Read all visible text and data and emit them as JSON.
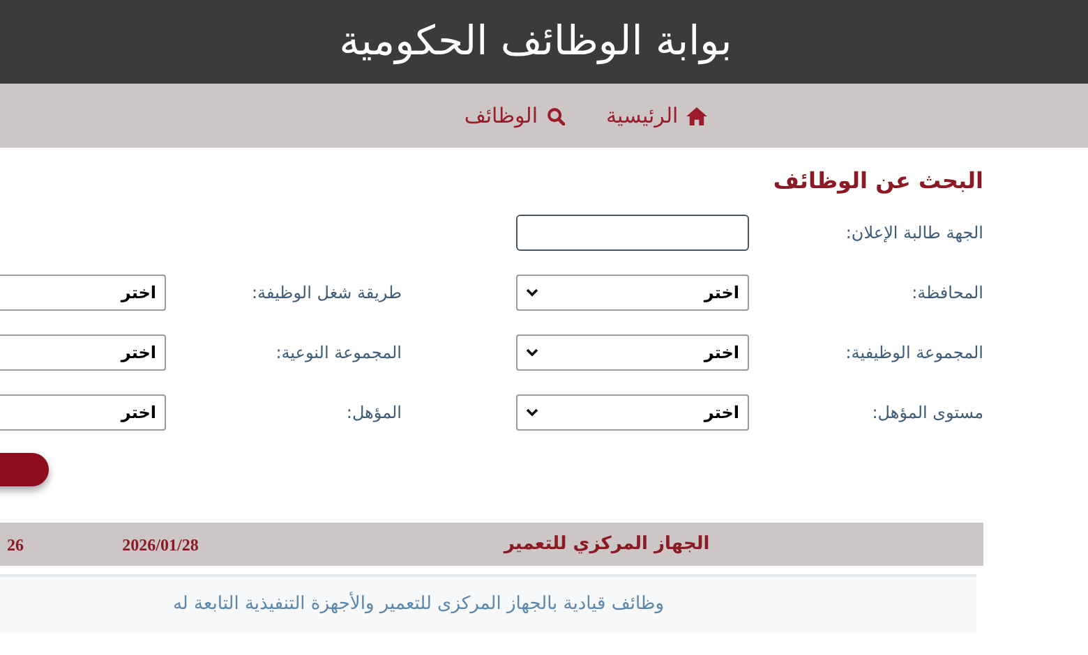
{
  "header": {
    "title": "بوابة الوظائف الحكومية"
  },
  "nav": [
    {
      "label": "الرئيسية",
      "kind": "home"
    },
    {
      "label": "الوظائف",
      "kind": "search"
    }
  ],
  "search_form": {
    "title": "البحث عن الوظائف",
    "rows": [
      {
        "fields": [
          {
            "label": "الجهة طالبة الإعلان:",
            "kind": "text"
          }
        ]
      },
      {
        "fields": [
          {
            "label": "المحافظة:",
            "kind": "select",
            "value": "اختر"
          },
          {
            "label": "طريقة شغل الوظيفة:",
            "kind": "select_cut",
            "value": "اختر"
          }
        ]
      },
      {
        "fields": [
          {
            "label": "المجموعة الوظيفية:",
            "kind": "select",
            "value": "اختر"
          },
          {
            "label": "المجموعة النوعية:",
            "kind": "select_cut",
            "value": "اختر"
          }
        ]
      },
      {
        "fields": [
          {
            "label": "مستوى المؤهل:",
            "kind": "select",
            "value": "اختر"
          },
          {
            "label": "المؤهل:",
            "kind": "select_cut",
            "value": "اختر"
          }
        ]
      }
    ]
  },
  "results": [
    {
      "title": "الجهاز المركزي للتعمير",
      "date": "2026/01/28",
      "column_3": "26",
      "description": "وظائف قيادية بالجهاز المركزى للتعمير والأجهزة التنفيذية التابعة له"
    }
  ]
}
